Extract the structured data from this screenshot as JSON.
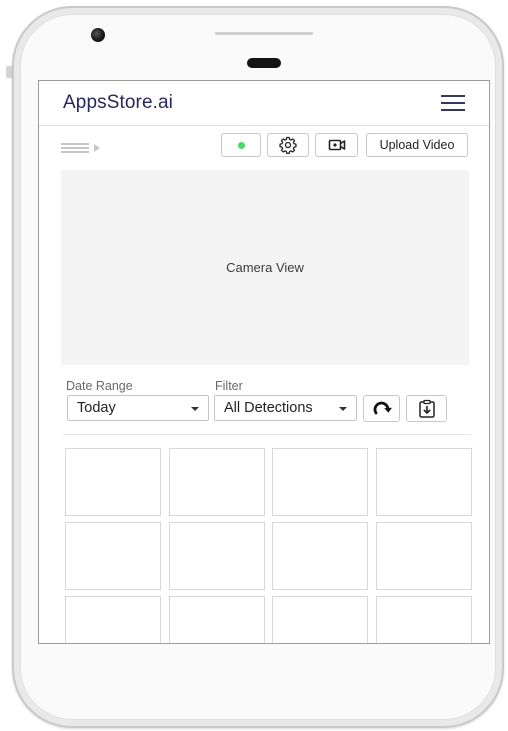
{
  "app": {
    "title": "AppsStore.ai"
  },
  "header": {
    "menu_icon": "hamburger-menu-icon"
  },
  "toolbar": {
    "panel_toggle_icon": "collapsed-panel-icon",
    "status_color": "#4cd964",
    "settings_icon": "gear-icon",
    "record_icon": "video-camera-icon",
    "upload_label": "Upload Video"
  },
  "camera": {
    "label": "Camera View"
  },
  "filters": {
    "date_range_label": "Date Range",
    "date_range_value": "Today",
    "filter_label": "Filter",
    "filter_value": "All Detections",
    "refresh_icon": "refresh-icon",
    "export_icon": "download-clipboard-icon"
  },
  "grid": {
    "rows": 3,
    "columns": 4
  },
  "colors": {
    "brand_text": "#27285a",
    "status_active": "#4cd964"
  }
}
